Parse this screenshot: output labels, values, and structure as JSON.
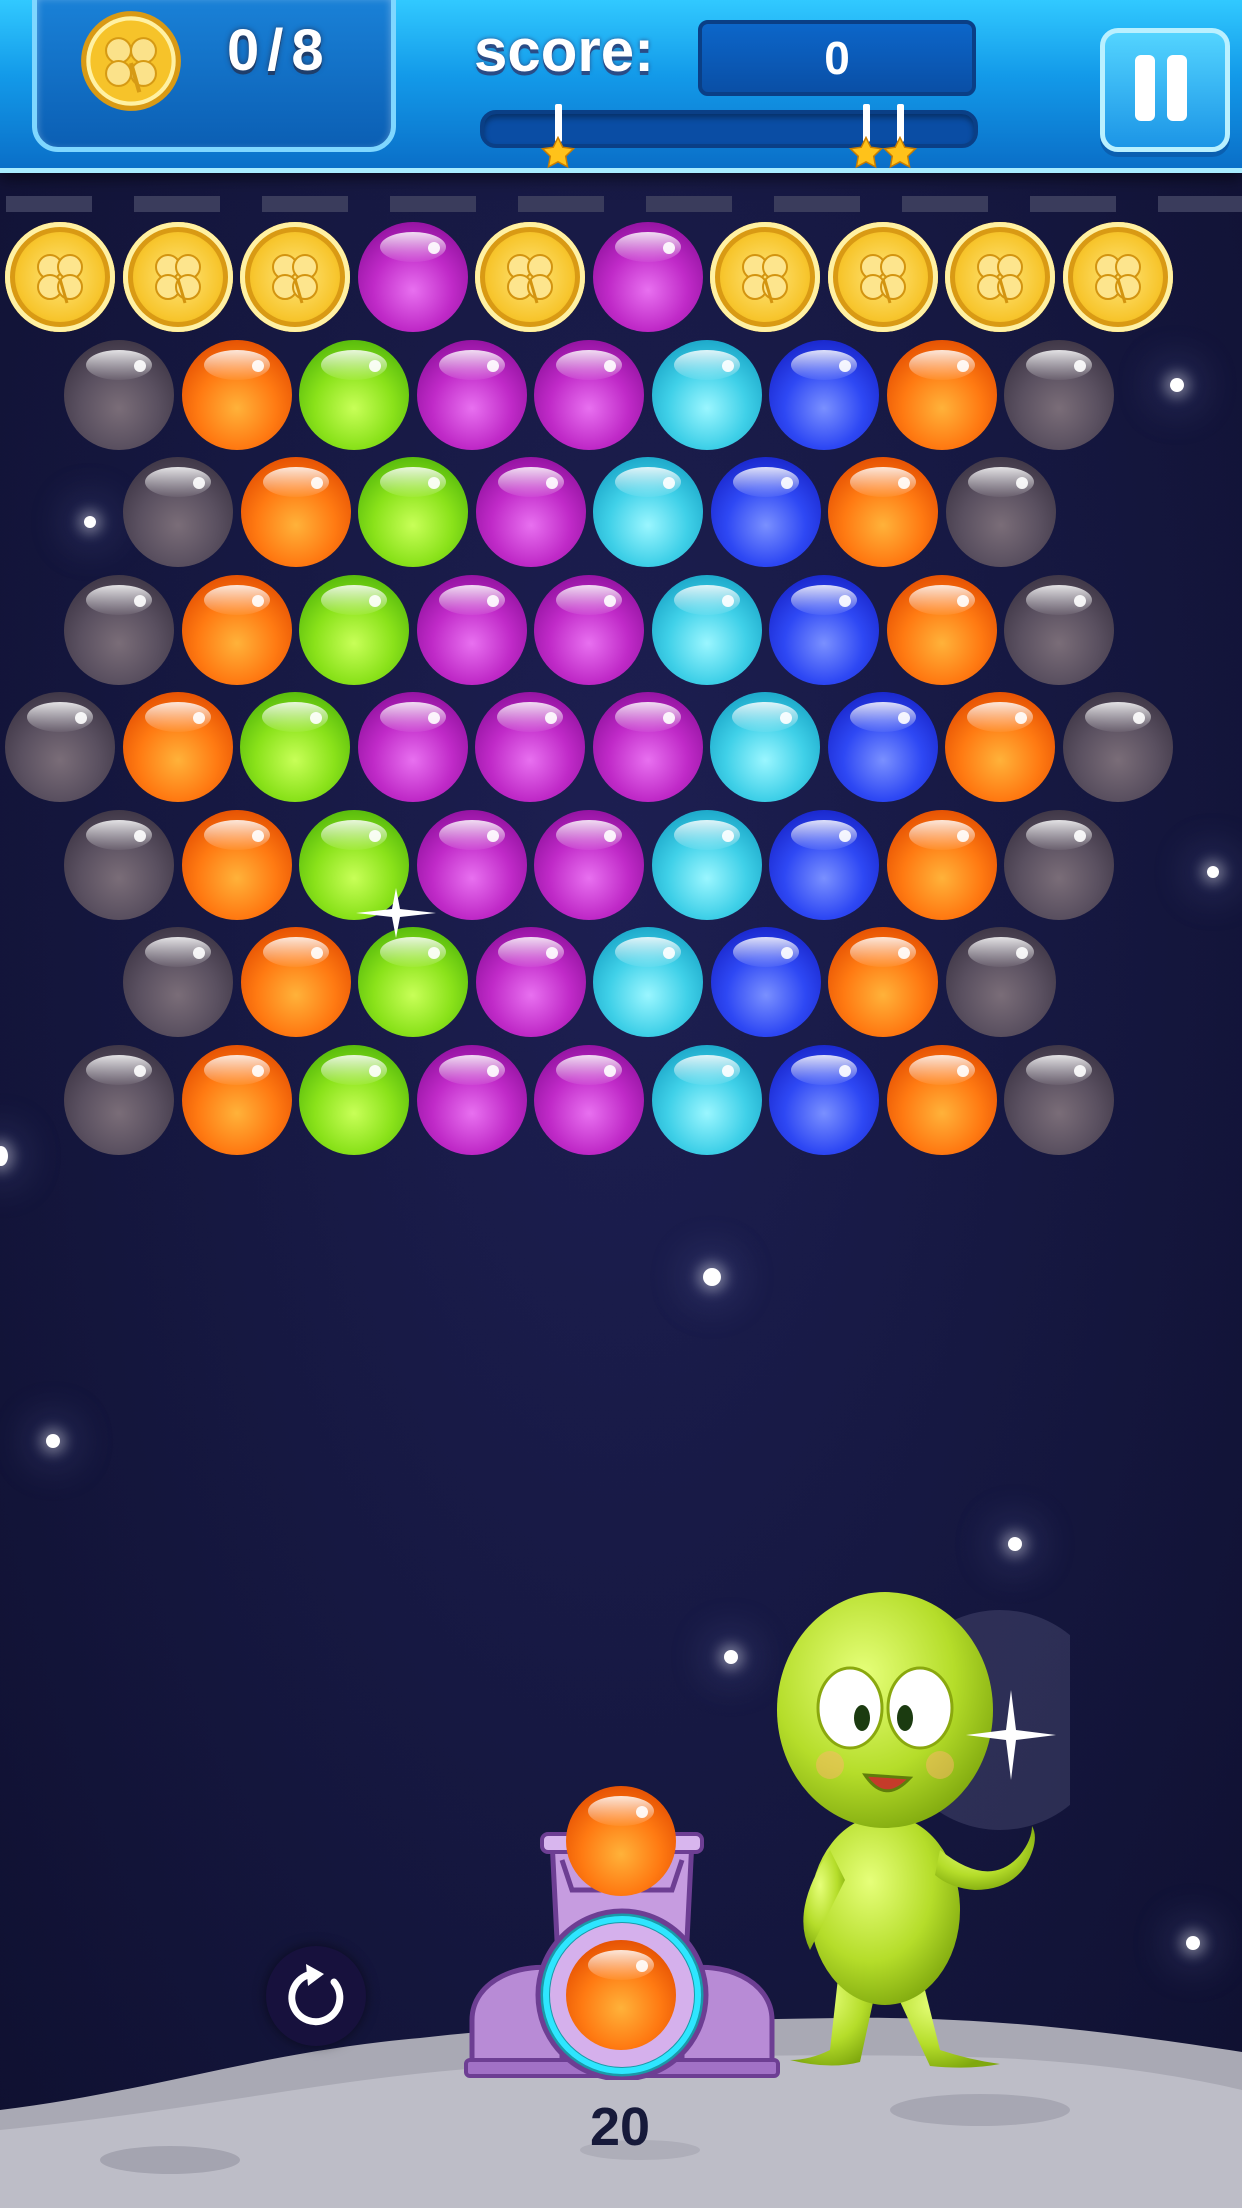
{
  "hud": {
    "coins_collected": "0",
    "coins_separator": "/",
    "coins_total": "8",
    "score_label": "score:",
    "score_value": "0",
    "score_progress_percent": 0,
    "star_thresholds_count": 3,
    "pause_icon": "pause-icon"
  },
  "launcher": {
    "shots_left": "20",
    "current_bubble": "orange",
    "next_bubble": "orange",
    "swap_icon": "refresh-icon"
  },
  "board": {
    "rows": [
      [
        "coin",
        "coin",
        "coin",
        "purple",
        "coin",
        "purple",
        "coin",
        "coin",
        "coin",
        "coin"
      ],
      [
        "gray",
        "orange",
        "green",
        "purple",
        "purple",
        "cyan",
        "blue",
        "orange",
        "gray"
      ],
      [
        "gray",
        "orange",
        "green",
        "purple",
        "cyan",
        "blue",
        "orange",
        "gray"
      ],
      [
        "gray",
        "orange",
        "green",
        "purple",
        "purple",
        "cyan",
        "blue",
        "orange",
        "gray"
      ],
      [
        "gray",
        "orange",
        "green",
        "purple",
        "purple",
        "purple",
        "cyan",
        "blue",
        "orange",
        "gray"
      ],
      [
        "gray",
        "orange",
        "green",
        "purple",
        "purple",
        "cyan",
        "blue",
        "orange",
        "gray"
      ],
      [
        "gray",
        "orange",
        "green",
        "purple",
        "cyan",
        "blue",
        "orange",
        "gray"
      ],
      [
        "gray",
        "orange",
        "green",
        "purple",
        "purple",
        "cyan",
        "blue",
        "orange",
        "gray"
      ]
    ]
  },
  "colors": {
    "hud_blue": "#139ae9",
    "background": "#15173f",
    "ground": "#b9b9c4",
    "alien": "#b5dd2a"
  }
}
